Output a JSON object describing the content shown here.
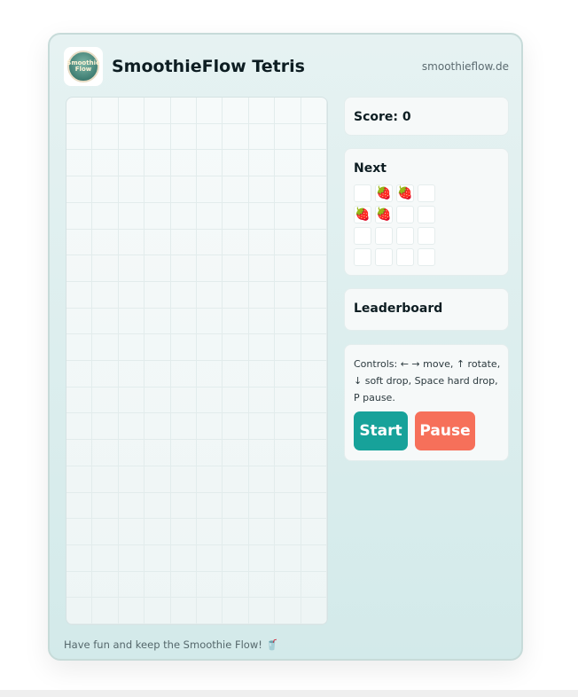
{
  "header": {
    "logo_text": "Smoothie Flow",
    "title": "SmoothieFlow Tetris",
    "domain": "smoothieflow.de"
  },
  "board": {
    "columns": 10,
    "rows": 20
  },
  "score": {
    "label": "Score: 0"
  },
  "next": {
    "heading": "Next",
    "glyph": "🍓",
    "grid": [
      [
        0,
        1,
        1,
        0
      ],
      [
        1,
        1,
        0,
        0
      ],
      [
        0,
        0,
        0,
        0
      ],
      [
        0,
        0,
        0,
        0
      ]
    ]
  },
  "leaderboard": {
    "heading": "Leaderboard"
  },
  "controls": {
    "text": "Controls: ← → move, ↑ rotate, ↓ soft drop, Space hard drop, P pause.",
    "start_label": "Start",
    "pause_label": "Pause"
  },
  "footer": {
    "text": "Have fun and keep the Smoothie Flow! 🥤"
  },
  "colors": {
    "start": "#17a29a",
    "pause": "#f6705a",
    "card_bg": "#dcecec"
  }
}
